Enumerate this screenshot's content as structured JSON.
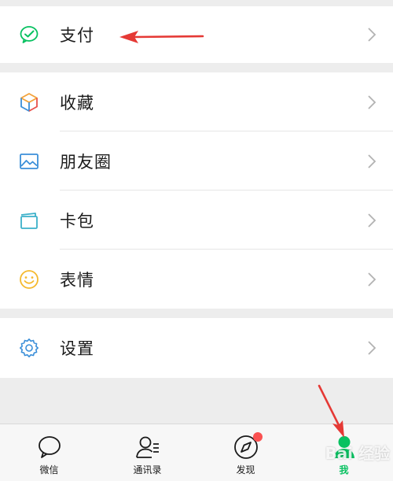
{
  "menu": {
    "pay": {
      "label": "支付",
      "icon": "wechat-pay-icon"
    },
    "favorites": {
      "label": "收藏",
      "icon": "cube-icon"
    },
    "moments": {
      "label": "朋友圈",
      "icon": "image-icon"
    },
    "cards": {
      "label": "卡包",
      "icon": "card-wallet-icon"
    },
    "stickers": {
      "label": "表情",
      "icon": "smiley-icon"
    },
    "settings": {
      "label": "设置",
      "icon": "gear-icon"
    }
  },
  "tabbar": {
    "items": [
      {
        "label": "微信",
        "icon": "chat-bubble-icon",
        "active": false
      },
      {
        "label": "通讯录",
        "icon": "contacts-icon",
        "active": false
      },
      {
        "label": "发现",
        "icon": "compass-icon",
        "active": false,
        "badge": true
      },
      {
        "label": "我",
        "icon": "person-icon",
        "active": true
      }
    ]
  },
  "colors": {
    "accent": "#07c160",
    "badge": "#fa5151",
    "annotation_arrow": "#e53935"
  },
  "watermark": "Bai 经验"
}
